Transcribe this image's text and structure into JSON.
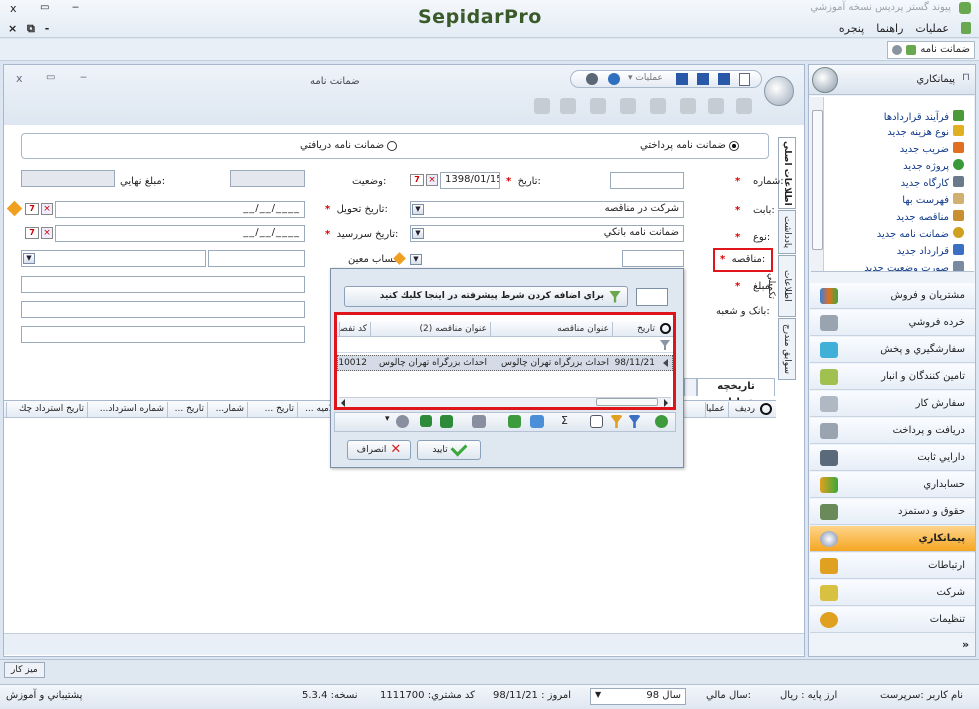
{
  "app": {
    "brand": "SepidarPro",
    "window_title": "پيوند گستر پرديس نسخه آموزشي",
    "menu": [
      "عمليات",
      "راهنما",
      "پنجره"
    ],
    "doc_tab": "ضمانت نامه"
  },
  "form": {
    "title": "ضمانت نامه",
    "actions_label": "عمليات",
    "radio_payment": "ضمانت نامه پرداختي",
    "radio_receipt": "ضمانت نامه دريافتي",
    "labels": {
      "number": "شماره:",
      "date": "تاريخ:",
      "status": "وضعيت:",
      "final_amount": "مبلغ نهايي:",
      "reason": "بابت:",
      "delivery_date": "تاريخ تحويل:",
      "type": "نوع:",
      "due_date": "تاريخ سررسيد:",
      "tender": "مناقصه:",
      "account": "حساب معين:",
      "amount": "مبلغ:",
      "bank": "بانک و شعبه:"
    },
    "values": {
      "date": "1398/01/15",
      "reason": "شرکت در مناقصه",
      "type": "ضمانت نامه بانکي",
      "date_placeholder": "__/__/____"
    },
    "history_tab": "تاريخچه عمليات",
    "side_tabs": [
      "اطلاعات اصلي",
      "يادداشت",
      "اطلاعات تکميلي",
      "سوابق مندرج"
    ]
  },
  "history_grid": {
    "columns": [
      "رديف",
      "عمليا",
      "لاميه ...",
      "تاريخ ...",
      "شمار...",
      "تاريخ ...",
      "شماره استرداد...",
      "تاريخ استرداد چك"
    ]
  },
  "popup": {
    "filter_button": "براي اضافه كردن شرط پيشرفته در اينجا كليك كنيد",
    "dots": "..........",
    "columns": [
      "تاريخ",
      "عنوان مناقصه",
      "عنوان مناقصه (2)",
      "كد تفصيل"
    ],
    "row": {
      "date": "98/11/21",
      "title": "احداث بزرگراه تهران چالوس",
      "title2": "احداث بزرگراه تهران چالوس",
      "code": "10012"
    },
    "ok": "تاييد",
    "cancel": "انصراف"
  },
  "sidebar": {
    "title": "پيمانکاري",
    "tree": [
      "فرآيند قراردادها",
      "نوع هزينه جديد",
      "ضريب جديد",
      "پروژه جديد",
      "کارگاه جديد",
      "فهرست بها",
      "مناقصه جديد",
      "ضمانت نامه جديد",
      "قرارداد جديد",
      "صورت وضعيت جديد"
    ],
    "modules": [
      "مشتريان و فروش",
      "خرده فروشي",
      "سفارشگيري و پخش",
      "تامين کنندگان و انبار",
      "سفارش کار",
      "دريافت و پرداخت",
      "دارايي ثابت",
      "حسابداري",
      "حقوق و دستمزد",
      "پيمانکاري",
      "ارتباطات",
      "شرکت",
      "تنظيمات"
    ],
    "active_module": "پيمانکاري"
  },
  "taskbar": {
    "desk": "ميز كار"
  },
  "status": {
    "support": "پشتيباني و آموزش",
    "version_label": "نسخه:",
    "version": "5.3.4",
    "customer_label": "كد مشتري:",
    "customer": "1111700",
    "today_label": "امروز :",
    "today": "98/11/21",
    "year": "سال 98",
    "fiscal_label": "سال مالي:",
    "currency": "ارز پايه : ريال",
    "user": "نام كاربر :سرپرست"
  },
  "colors": {
    "accent": "#f6a623",
    "highlight": "#e0141b",
    "brand": "#3a5a2a",
    "window": "#dce6f2"
  }
}
